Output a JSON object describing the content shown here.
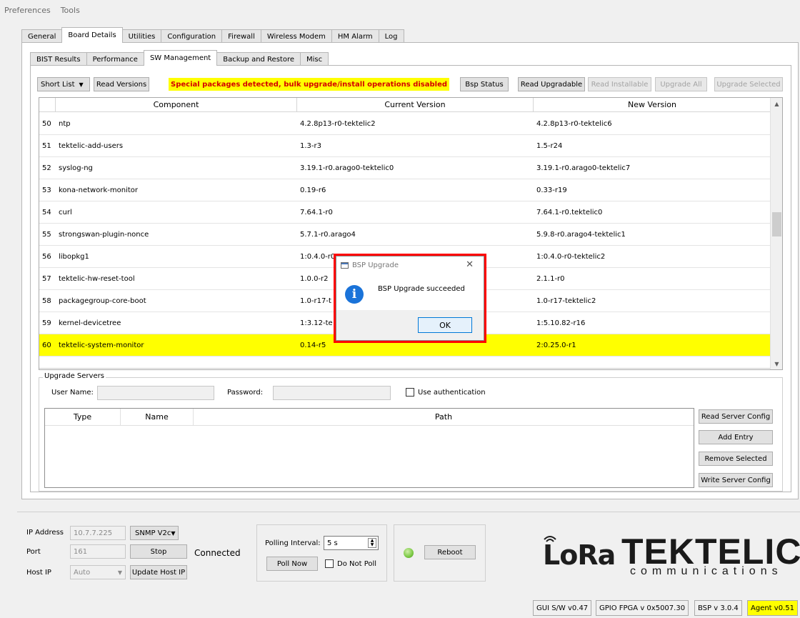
{
  "menu": [
    "Preferences",
    "Tools"
  ],
  "main_tabs": [
    "General",
    "Board Details",
    "Utilities",
    "Configuration",
    "Firewall",
    "Wireless Modem",
    "HM Alarm",
    "Log"
  ],
  "sub_tabs": [
    "BIST Results",
    "Performance",
    "SW Management",
    "Backup and Restore",
    "Misc"
  ],
  "toolbar": {
    "short_list": "Short List",
    "read_versions": "Read Versions",
    "warning": "Special packages detected, bulk upgrade/install operations disabled",
    "bsp_status": "Bsp Status",
    "read_upgradable": "Read Upgradable",
    "read_installable": "Read Installable",
    "upgrade_all": "Upgrade All",
    "upgrade_selected": "Upgrade Selected"
  },
  "table": {
    "headers": [
      "Component",
      "Current Version",
      "New Version"
    ],
    "rows": [
      {
        "num": "50",
        "component": "ntp",
        "current": "4.2.8p13-r0-tektelic2",
        "new": "4.2.8p13-r0-tektelic6"
      },
      {
        "num": "51",
        "component": "tektelic-add-users",
        "current": "1.3-r3",
        "new": "1.5-r24"
      },
      {
        "num": "52",
        "component": "syslog-ng",
        "current": "3.19.1-r0.arago0-tektelic0",
        "new": "3.19.1-r0.arago0-tektelic7"
      },
      {
        "num": "53",
        "component": "kona-network-monitor",
        "current": "0.19-r6",
        "new": "0.33-r19"
      },
      {
        "num": "54",
        "component": "curl",
        "current": "7.64.1-r0",
        "new": "7.64.1-r0.tektelic0"
      },
      {
        "num": "55",
        "component": "strongswan-plugin-nonce",
        "current": "5.7.1-r0.arago4",
        "new": "5.9.8-r0.arago4-tektelic1"
      },
      {
        "num": "56",
        "component": "libopkg1",
        "current": "1:0.4.0-r0",
        "new": "1:0.4.0-r0-tektelic2"
      },
      {
        "num": "57",
        "component": "tektelic-hw-reset-tool",
        "current": "1.0.0-r2",
        "new": "2.1.1-r0"
      },
      {
        "num": "58",
        "component": "packagegroup-core-boot",
        "current": "1.0-r17-t",
        "new": "1.0-r17-tektelic2"
      },
      {
        "num": "59",
        "component": "kernel-devicetree",
        "current": "1:3.12-te",
        "new": "1:5.10.82-r16"
      },
      {
        "num": "60",
        "component": "tektelic-system-monitor",
        "current": "0.14-r5",
        "new": "2:0.25.0-r1"
      }
    ]
  },
  "servers": {
    "group_title": "Upgrade Servers",
    "user_label": "User Name:",
    "password_label": "Password:",
    "auth_label": "Use authentication",
    "headers": [
      "Type",
      "Name",
      "Path"
    ],
    "read_config": "Read Server Config",
    "add_entry": "Add Entry",
    "remove_selected": "Remove Selected",
    "write_config": "Write Server Config"
  },
  "connection": {
    "ip_label": "IP Address",
    "ip_value": "10.7.7.225",
    "snmp": "SNMP V2c",
    "port_label": "Port",
    "port_value": "161",
    "stop": "Stop",
    "status": "Connected",
    "host_label": "Host IP",
    "host_value": "Auto",
    "update_host": "Update Host IP",
    "polling_label": "Polling Interval:",
    "polling_value": "5 s",
    "poll_now": "Poll Now",
    "do_not_poll": "Do Not Poll",
    "reboot": "Reboot"
  },
  "dialog": {
    "title": "BSP Upgrade",
    "message": "BSP Upgrade succeeded",
    "ok": "OK"
  },
  "logo": {
    "lora": "LoRa",
    "brand": "TEKTELIC",
    "sub": "communications"
  },
  "status_bar": [
    "GUI S/W v0.47",
    "GPIO FPGA v 0x5007.30",
    "BSP v 3.0.4",
    "Agent v0.51"
  ],
  "colors": {
    "highlight": "#ffff00",
    "warning_text": "#d40000",
    "dialog_border": "#ff0000",
    "info_icon": "#1a73d9",
    "led": "#7ac943"
  }
}
